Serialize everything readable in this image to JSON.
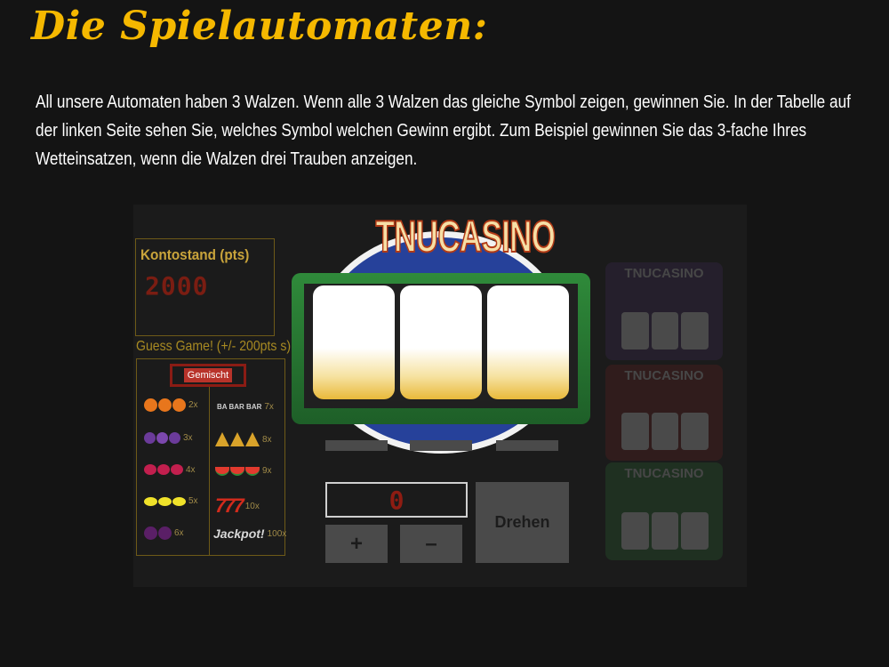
{
  "page": {
    "title": "Die Spielautomaten:",
    "intro": "All unsere Automaten haben 3 Walzen. Wenn alle 3 Walzen das gleiche Symbol zeigen, gewinnen Sie. In der Tabelle auf der linken Seite sehen Sie, welches Symbol welchen Gewinn ergibt. Zum Beispiel gewinnen Sie das 3-fache Ihres Wetteinsatzen, wenn die Walzen drei Trauben anzeigen."
  },
  "machine": {
    "balance_label": "Kontostand (pts)",
    "balance_value": "2000",
    "guess_game_label": "Guess Game! (+/- 200pts s)",
    "mode_button": "Gemischt",
    "logo": "TNUCASINO",
    "bet_value": "0",
    "plus_label": "+",
    "minus_label": "–",
    "spin_label": "Drehen",
    "paytable": {
      "left": [
        {
          "symbol": "orange-icon",
          "multiplier": "2x"
        },
        {
          "symbol": "grapes-icon",
          "multiplier": "3x"
        },
        {
          "symbol": "cherry-icon",
          "multiplier": "4x"
        },
        {
          "symbol": "lemon-icon",
          "multiplier": "5x"
        },
        {
          "symbol": "plum-icon",
          "multiplier": "6x"
        }
      ],
      "right": [
        {
          "symbol": "bar-icon",
          "label": "BA BAR BAR",
          "multiplier": "7x"
        },
        {
          "symbol": "bell-icon",
          "multiplier": "8x"
        },
        {
          "symbol": "watermelon-icon",
          "multiplier": "9x"
        },
        {
          "symbol": "seven-icon",
          "label": "777",
          "multiplier": "10x"
        },
        {
          "symbol": "jackpot-icon",
          "label": "Jackpot!",
          "multiplier": "100x"
        }
      ]
    }
  },
  "theme_thumbnails": [
    {
      "name": "classic-purple",
      "logo": "TNUCASINO",
      "color": "#4a2f6a"
    },
    {
      "name": "red-gold",
      "logo": "TNUCASINO",
      "color": "#7a2020"
    },
    {
      "name": "green-red",
      "logo": "TNUCASINO",
      "color": "#2e7a36"
    }
  ],
  "colors": {
    "title": "#f5b800",
    "accent_gold": "#a88a22",
    "digit_red": "#8e1c12",
    "reel_frame": "#2f8a3a",
    "logo_disc": "#26419a"
  }
}
